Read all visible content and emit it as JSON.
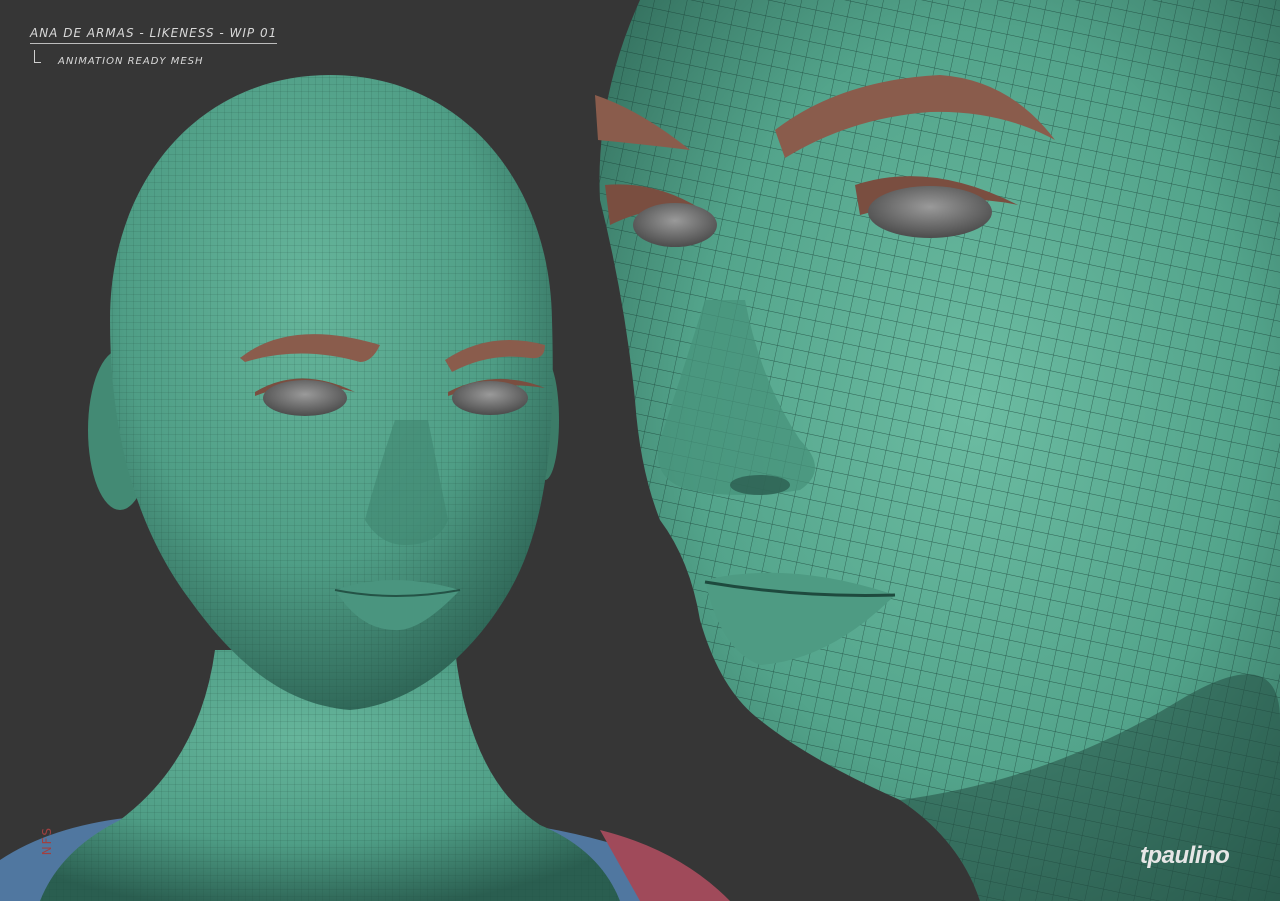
{
  "artwork": {
    "title": "ANA DE ARMAS - LIKENESS - WIP 01",
    "subtitle": "ANIMATION READY MESH",
    "signature": "tpaulino",
    "side_mark": "NFS"
  },
  "colors": {
    "background": "#363636",
    "skin": "#4f9e86",
    "skin_dark": "#2f6e5d",
    "brow": "#8a5c4c",
    "eye": "#6f6f6f",
    "shirt_blue": "#5077a0",
    "shirt_red": "#a04a5a",
    "wire": "#1e4a3e"
  }
}
